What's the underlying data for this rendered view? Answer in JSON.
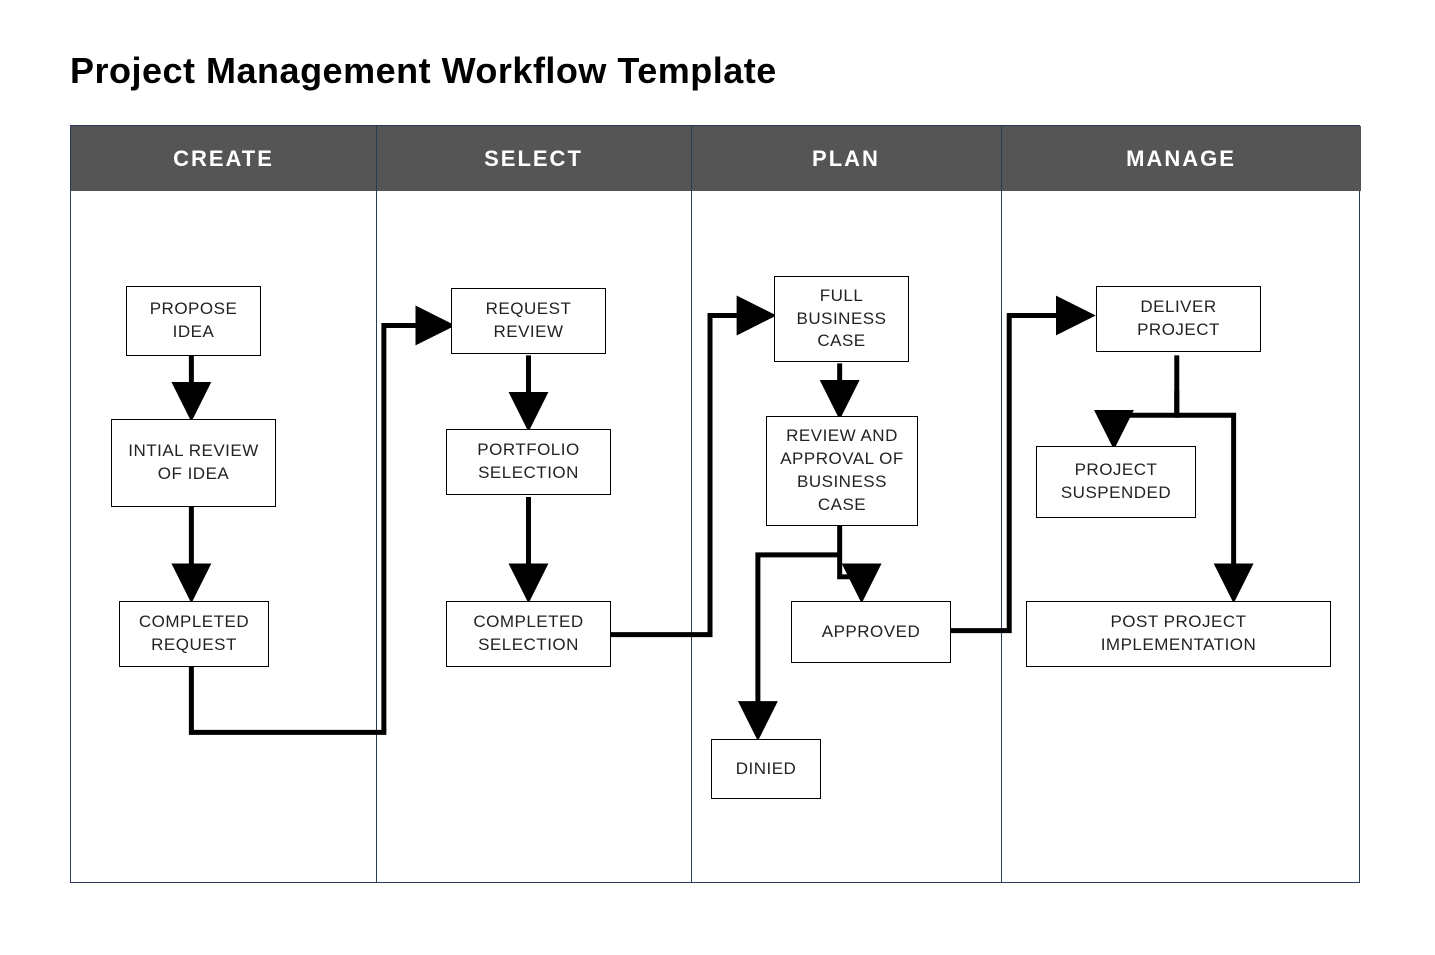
{
  "title": "Project Management Workflow Template",
  "colors": {
    "header_bg": "#555555",
    "header_text": "#ffffff",
    "frame_border": "#2c3a5a",
    "node_border": "#000000",
    "node_bg": "#ffffff",
    "arrow": "#000000"
  },
  "lanes": [
    {
      "id": "create",
      "label": "CREATE"
    },
    {
      "id": "select",
      "label": "SELECT"
    },
    {
      "id": "plan",
      "label": "PLAN"
    },
    {
      "id": "manage",
      "label": "MANAGE"
    }
  ],
  "nodes": {
    "propose_idea": {
      "label": "PROPOSE IDEA",
      "lane": "create"
    },
    "initial_review": {
      "label": "INTIAL REVIEW OF IDEA",
      "lane": "create"
    },
    "completed_request": {
      "label": "COMPLETED REQUEST",
      "lane": "create"
    },
    "request_review": {
      "label": "REQUEST REVIEW",
      "lane": "select"
    },
    "portfolio_selection": {
      "label": "PORTFOLIO SELECTION",
      "lane": "select"
    },
    "completed_selection": {
      "label": "COMPLETED SELECTION",
      "lane": "select"
    },
    "full_business_case": {
      "label": "FULL BUSINESS CASE",
      "lane": "plan"
    },
    "review_approval": {
      "label": "REVIEW AND APPROVAL OF BUSINESS CASE",
      "lane": "plan"
    },
    "approved": {
      "label": "APPROVED",
      "lane": "plan"
    },
    "denied": {
      "label": "DINIED",
      "lane": "plan"
    },
    "deliver_project": {
      "label": "DELIVER PROJECT",
      "lane": "manage"
    },
    "project_suspended": {
      "label": "PROJECT SUSPENDED",
      "lane": "manage"
    },
    "post_impl": {
      "label": "POST PROJECT IMPLEMENTATION",
      "lane": "manage"
    }
  },
  "edges": [
    {
      "from": "propose_idea",
      "to": "initial_review"
    },
    {
      "from": "initial_review",
      "to": "completed_request"
    },
    {
      "from": "completed_request",
      "to": "request_review"
    },
    {
      "from": "request_review",
      "to": "portfolio_selection"
    },
    {
      "from": "portfolio_selection",
      "to": "completed_selection"
    },
    {
      "from": "completed_selection",
      "to": "full_business_case"
    },
    {
      "from": "full_business_case",
      "to": "review_approval"
    },
    {
      "from": "review_approval",
      "to": "approved"
    },
    {
      "from": "review_approval",
      "to": "denied"
    },
    {
      "from": "approved",
      "to": "deliver_project"
    },
    {
      "from": "deliver_project",
      "to": "project_suspended"
    },
    {
      "from": "deliver_project",
      "to": "post_impl"
    }
  ]
}
